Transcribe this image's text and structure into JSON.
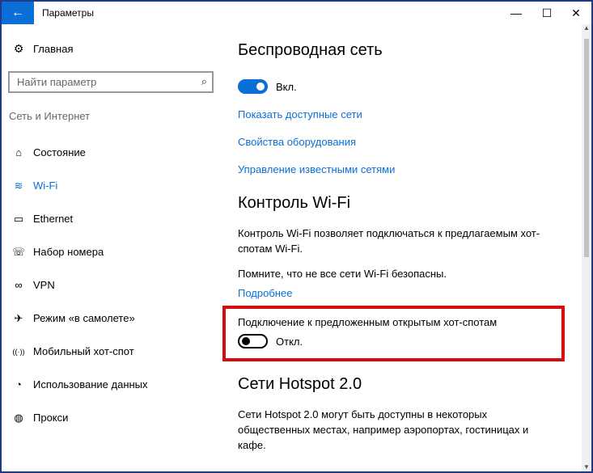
{
  "window": {
    "title": "Параметры",
    "back_icon": "←",
    "minimize_icon": "—",
    "maximize_icon": "☐",
    "close_icon": "✕"
  },
  "sidebar": {
    "home": {
      "label": "Главная",
      "icon": "⚙"
    },
    "search": {
      "placeholder": "Найти параметр",
      "icon": "⌕"
    },
    "section_label": "Сеть и Интернет",
    "items": [
      {
        "label": "Состояние",
        "icon": "⌂",
        "active": false
      },
      {
        "label": "Wi-Fi",
        "icon": "≋",
        "active": true
      },
      {
        "label": "Ethernet",
        "icon": "▭",
        "active": false
      },
      {
        "label": "Набор номера",
        "icon": "☏",
        "active": false
      },
      {
        "label": "VPN",
        "icon": "∞",
        "active": false
      },
      {
        "label": "Режим «в самолете»",
        "icon": "✈",
        "active": false
      },
      {
        "label": "Мобильный хот-спот",
        "icon": "((·))",
        "active": false
      },
      {
        "label": "Использование данных",
        "icon": "◔",
        "active": false
      },
      {
        "label": "Прокси",
        "icon": "◍",
        "active": false
      }
    ]
  },
  "main": {
    "wireless_heading": "Беспроводная сеть",
    "wireless_toggle_label": "Вкл.",
    "links": [
      "Показать доступные сети",
      "Свойства оборудования",
      "Управление известными сетями"
    ],
    "wifi_sense_heading": "Контроль Wi-Fi",
    "wifi_sense_desc_1": "Контроль Wi-Fi позволяет подключаться к предлагаемым хот-",
    "wifi_sense_desc_2": "спотам Wi-Fi.",
    "wifi_sense_warning": "Помните, что не все сети Wi-Fi безопасны.",
    "more_link": "Подробнее",
    "open_hotspots_label": "Подключение к предложенным открытым хот-спотам",
    "open_hotspots_toggle_label": "Откл.",
    "hotspot2_heading": "Сети Hotspot 2.0",
    "hotspot2_desc_1": "Сети Hotspot 2.0 могут быть доступны в некоторых",
    "hotspot2_desc_2": "общественных местах, например аэропортах, гостиницах и",
    "hotspot2_desc_3": "кафе."
  },
  "colors": {
    "accent": "#0a6fd6",
    "highlight_border": "#d60d0d",
    "frame_border": "#1f3a8a"
  }
}
